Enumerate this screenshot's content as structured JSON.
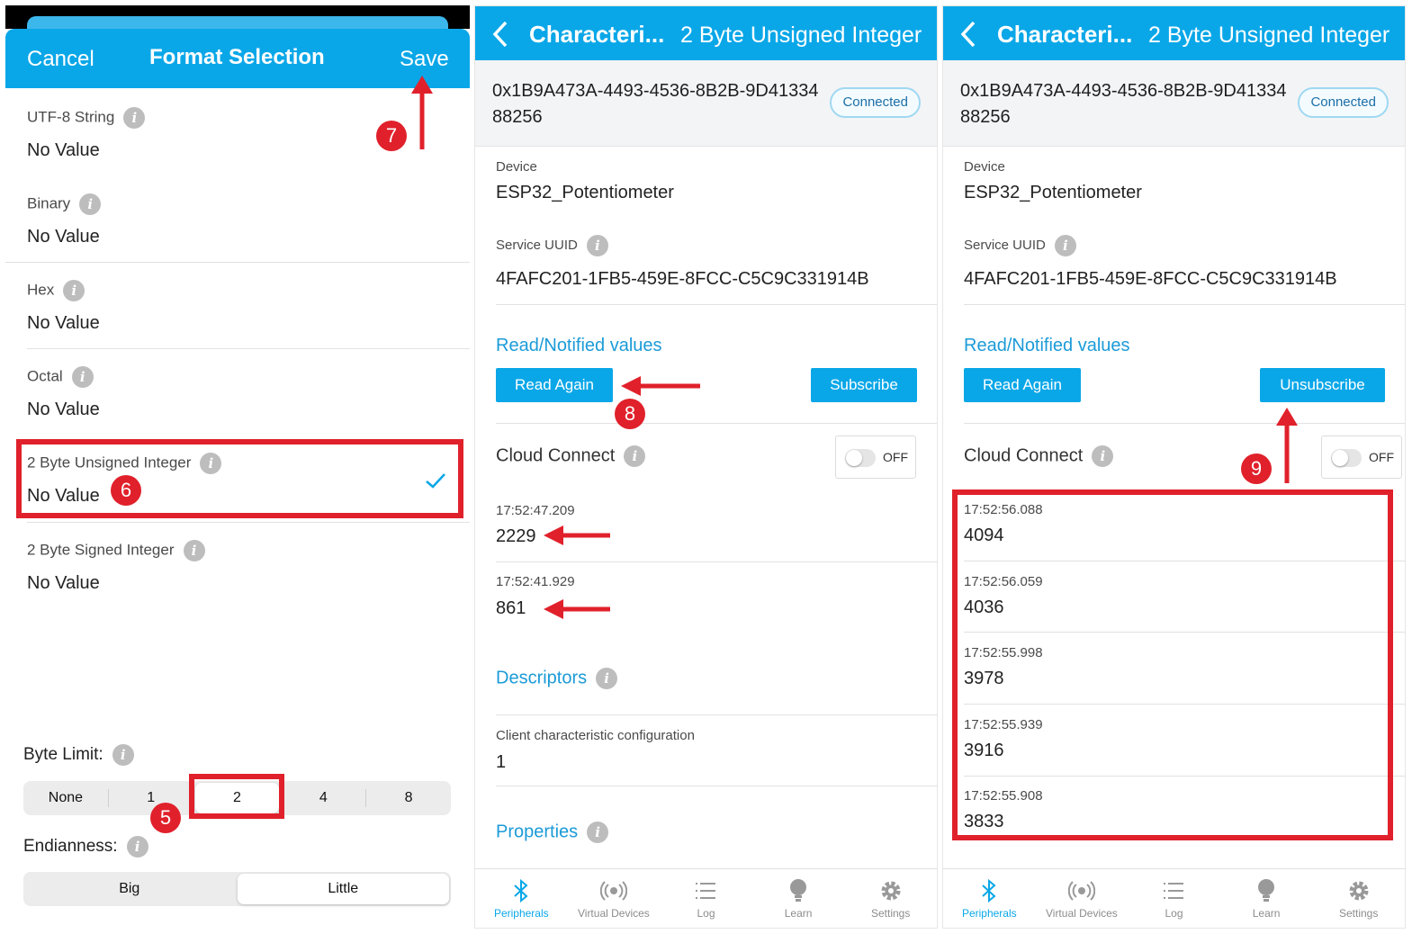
{
  "panel1": {
    "cancel": "Cancel",
    "title": "Format Selection",
    "save": "Save",
    "formats": [
      {
        "label": "UTF-8 String",
        "value": "No Value"
      },
      {
        "label": "Binary",
        "value": "No Value"
      },
      {
        "label": "Hex",
        "value": "No Value"
      },
      {
        "label": "Octal",
        "value": "No Value"
      },
      {
        "label": "2 Byte Unsigned Integer",
        "value": "No Value"
      },
      {
        "label": "2 Byte Signed Integer",
        "value": "No Value"
      }
    ],
    "byte_limit_label": "Byte Limit:",
    "byte_limit_options": [
      "None",
      "1",
      "2",
      "4",
      "8"
    ],
    "endianness_label": "Endianness:",
    "endianness_options": [
      "Big",
      "Little"
    ]
  },
  "panel2": {
    "title": "Characteri...",
    "subtitle": "2 Byte Unsigned Integer",
    "uuid": "0x1B9A473A-4493-4536-8B2B-9D4133488256",
    "status": "Connected",
    "device_label": "Device",
    "device_value": "ESP32_Potentiometer",
    "service_label": "Service UUID",
    "service_value": "4FAFC201-1FB5-459E-8FCC-C5C9C331914B",
    "read_title": "Read/Notified values",
    "read_again": "Read Again",
    "subscribe": "Subscribe",
    "cloud": "Cloud Connect",
    "toggle": "OFF",
    "values": [
      {
        "time": "17:52:47.209",
        "value": "2229"
      },
      {
        "time": "17:52:41.929",
        "value": "861"
      }
    ],
    "descriptors": "Descriptors",
    "ccc_label": "Client characteristic configuration",
    "ccc_value": "1",
    "properties": "Properties"
  },
  "panel3": {
    "title": "Characteri...",
    "subtitle": "2 Byte Unsigned Integer",
    "uuid": "0x1B9A473A-4493-4536-8B2B-9D4133488256",
    "status": "Connected",
    "device_label": "Device",
    "device_value": "ESP32_Potentiometer",
    "service_label": "Service UUID",
    "service_value": "4FAFC201-1FB5-459E-8FCC-C5C9C331914B",
    "read_title": "Read/Notified values",
    "read_again": "Read Again",
    "unsubscribe": "Unsubscribe",
    "cloud": "Cloud Connect",
    "toggle": "OFF",
    "values": [
      {
        "time": "17:52:56.088",
        "value": "4094"
      },
      {
        "time": "17:52:56.059",
        "value": "4036"
      },
      {
        "time": "17:52:55.998",
        "value": "3978"
      },
      {
        "time": "17:52:55.939",
        "value": "3916"
      },
      {
        "time": "17:52:55.908",
        "value": "3833"
      }
    ]
  },
  "tabs": [
    "Peripherals",
    "Virtual Devices",
    "Log",
    "Learn",
    "Settings"
  ],
  "annotations": {
    "n5": "5",
    "n6": "6",
    "n7": "7",
    "n8": "8",
    "n9": "9"
  },
  "colors": {
    "accent": "#0aa7e8",
    "annotation": "#e0212b"
  }
}
